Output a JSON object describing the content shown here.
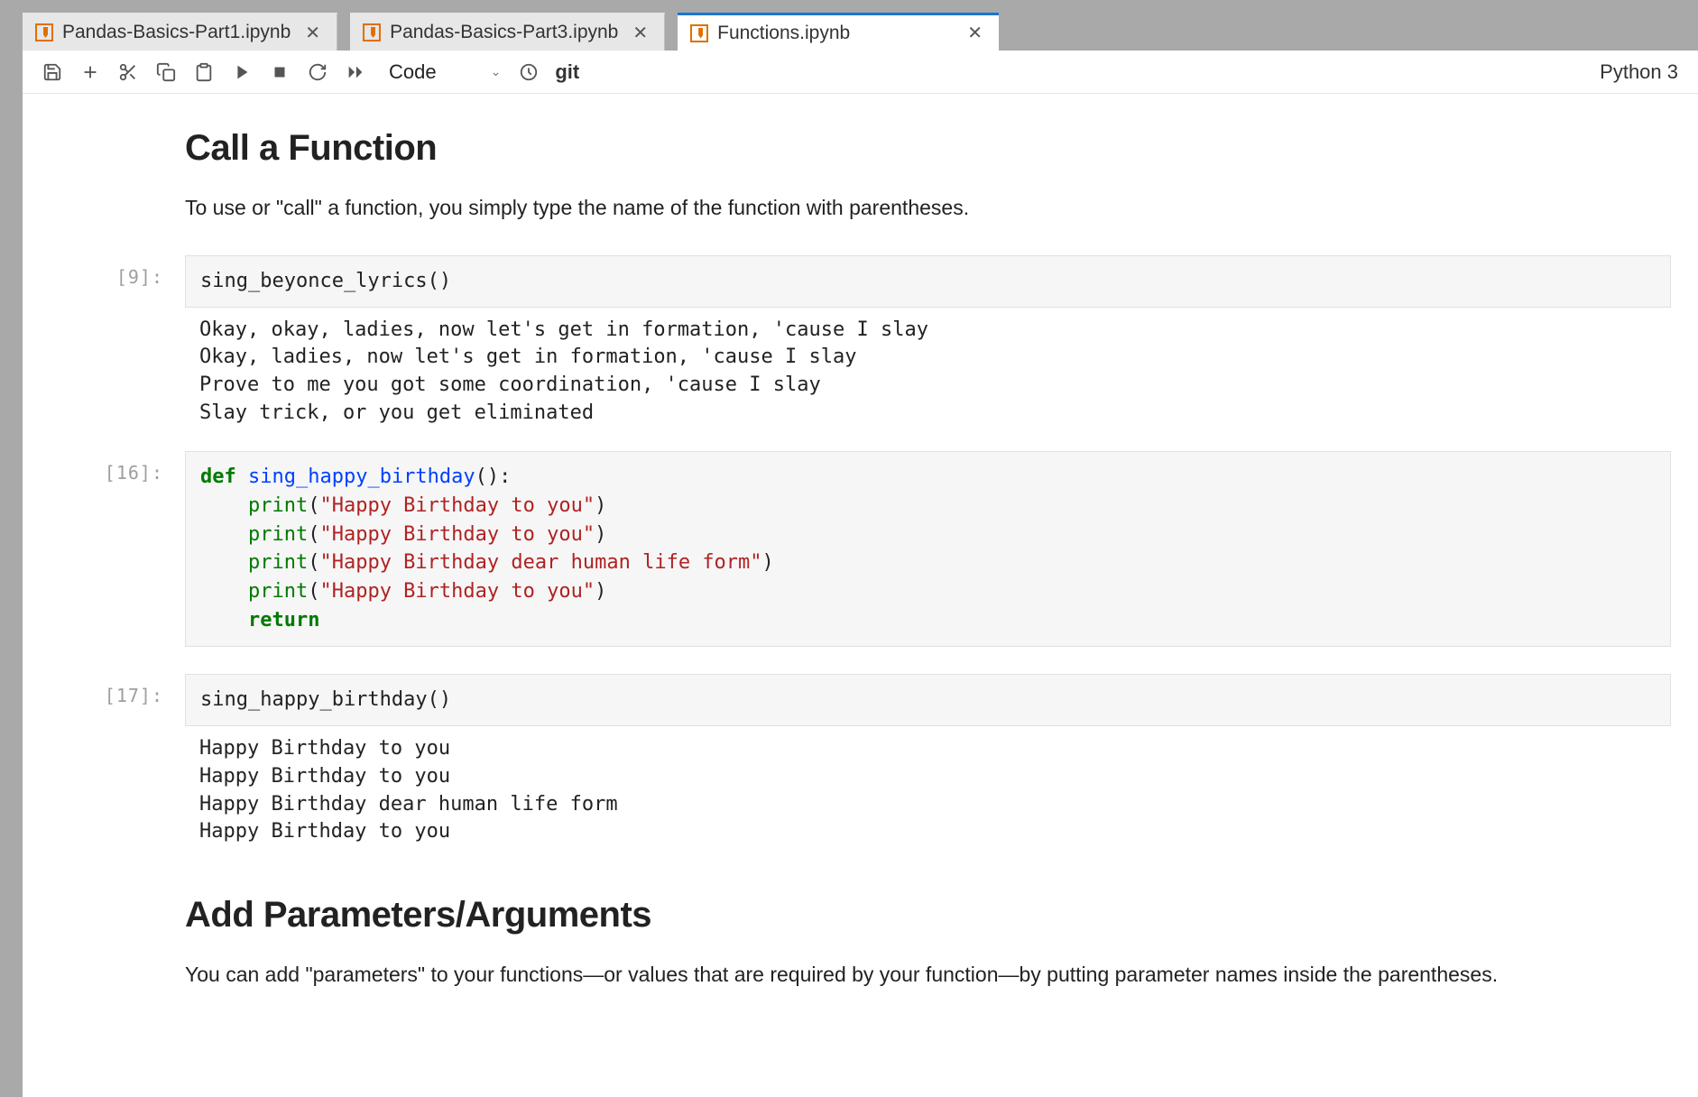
{
  "tabs": [
    {
      "label": "Pandas-Basics-Part1.ipynb",
      "active": false
    },
    {
      "label": "Pandas-Basics-Part3.ipynb",
      "active": false
    },
    {
      "label": "Functions.ipynb",
      "active": true
    }
  ],
  "toolbar": {
    "cell_type": "Code",
    "git_label": "git",
    "kernel": "Python 3"
  },
  "cells": {
    "md1": {
      "heading": "Call a Function",
      "paragraph": "To use or \"call\" a function, you simply type the name of the function with parentheses."
    },
    "c9": {
      "prompt": "[9]:",
      "code_plain": "sing_beyonce_lyrics()",
      "output": "Okay, okay, ladies, now let's get in formation, 'cause I slay\nOkay, ladies, now let's get in formation, 'cause I slay\nProve to me you got some coordination, 'cause I slay\nSlay trick, or you get eliminated"
    },
    "c16": {
      "prompt": "[16]:",
      "kw_def": "def",
      "fn_name": "sing_happy_birthday",
      "paren_colon": "():",
      "indent": "    ",
      "print_name": "print",
      "str1": "\"Happy Birthday to you\"",
      "str2": "\"Happy Birthday to you\"",
      "str3": "\"Happy Birthday dear human life form\"",
      "str4": "\"Happy Birthday to you\"",
      "kw_return": "return",
      "open_p": "(",
      "close_p": ")"
    },
    "c17": {
      "prompt": "[17]:",
      "code_plain": "sing_happy_birthday()",
      "output": "Happy Birthday to you\nHappy Birthday to you\nHappy Birthday dear human life form\nHappy Birthday to you"
    },
    "md2": {
      "heading": "Add Parameters/Arguments",
      "paragraph": "You can add \"parameters\" to your functions—or values that are required by your function—by putting parameter names inside the parentheses."
    }
  }
}
